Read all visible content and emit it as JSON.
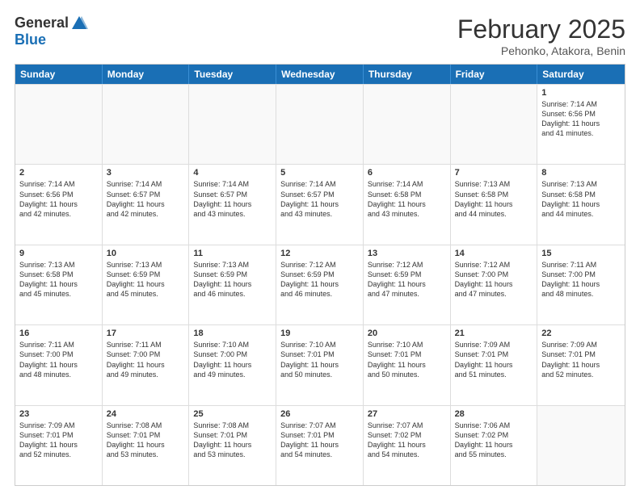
{
  "header": {
    "logo_general": "General",
    "logo_blue": "Blue",
    "month_title": "February 2025",
    "subtitle": "Pehonko, Atakora, Benin"
  },
  "days_of_week": [
    "Sunday",
    "Monday",
    "Tuesday",
    "Wednesday",
    "Thursday",
    "Friday",
    "Saturday"
  ],
  "weeks": [
    [
      {
        "day": "",
        "lines": [],
        "empty": true
      },
      {
        "day": "",
        "lines": [],
        "empty": true
      },
      {
        "day": "",
        "lines": [],
        "empty": true
      },
      {
        "day": "",
        "lines": [],
        "empty": true
      },
      {
        "day": "",
        "lines": [],
        "empty": true
      },
      {
        "day": "",
        "lines": [],
        "empty": true
      },
      {
        "day": "1",
        "lines": [
          "Sunrise: 7:14 AM",
          "Sunset: 6:56 PM",
          "Daylight: 11 hours",
          "and 41 minutes."
        ]
      }
    ],
    [
      {
        "day": "2",
        "lines": [
          "Sunrise: 7:14 AM",
          "Sunset: 6:56 PM",
          "Daylight: 11 hours",
          "and 42 minutes."
        ]
      },
      {
        "day": "3",
        "lines": [
          "Sunrise: 7:14 AM",
          "Sunset: 6:57 PM",
          "Daylight: 11 hours",
          "and 42 minutes."
        ]
      },
      {
        "day": "4",
        "lines": [
          "Sunrise: 7:14 AM",
          "Sunset: 6:57 PM",
          "Daylight: 11 hours",
          "and 43 minutes."
        ]
      },
      {
        "day": "5",
        "lines": [
          "Sunrise: 7:14 AM",
          "Sunset: 6:57 PM",
          "Daylight: 11 hours",
          "and 43 minutes."
        ]
      },
      {
        "day": "6",
        "lines": [
          "Sunrise: 7:14 AM",
          "Sunset: 6:58 PM",
          "Daylight: 11 hours",
          "and 43 minutes."
        ]
      },
      {
        "day": "7",
        "lines": [
          "Sunrise: 7:13 AM",
          "Sunset: 6:58 PM",
          "Daylight: 11 hours",
          "and 44 minutes."
        ]
      },
      {
        "day": "8",
        "lines": [
          "Sunrise: 7:13 AM",
          "Sunset: 6:58 PM",
          "Daylight: 11 hours",
          "and 44 minutes."
        ]
      }
    ],
    [
      {
        "day": "9",
        "lines": [
          "Sunrise: 7:13 AM",
          "Sunset: 6:58 PM",
          "Daylight: 11 hours",
          "and 45 minutes."
        ]
      },
      {
        "day": "10",
        "lines": [
          "Sunrise: 7:13 AM",
          "Sunset: 6:59 PM",
          "Daylight: 11 hours",
          "and 45 minutes."
        ]
      },
      {
        "day": "11",
        "lines": [
          "Sunrise: 7:13 AM",
          "Sunset: 6:59 PM",
          "Daylight: 11 hours",
          "and 46 minutes."
        ]
      },
      {
        "day": "12",
        "lines": [
          "Sunrise: 7:12 AM",
          "Sunset: 6:59 PM",
          "Daylight: 11 hours",
          "and 46 minutes."
        ]
      },
      {
        "day": "13",
        "lines": [
          "Sunrise: 7:12 AM",
          "Sunset: 6:59 PM",
          "Daylight: 11 hours",
          "and 47 minutes."
        ]
      },
      {
        "day": "14",
        "lines": [
          "Sunrise: 7:12 AM",
          "Sunset: 7:00 PM",
          "Daylight: 11 hours",
          "and 47 minutes."
        ]
      },
      {
        "day": "15",
        "lines": [
          "Sunrise: 7:11 AM",
          "Sunset: 7:00 PM",
          "Daylight: 11 hours",
          "and 48 minutes."
        ]
      }
    ],
    [
      {
        "day": "16",
        "lines": [
          "Sunrise: 7:11 AM",
          "Sunset: 7:00 PM",
          "Daylight: 11 hours",
          "and 48 minutes."
        ]
      },
      {
        "day": "17",
        "lines": [
          "Sunrise: 7:11 AM",
          "Sunset: 7:00 PM",
          "Daylight: 11 hours",
          "and 49 minutes."
        ]
      },
      {
        "day": "18",
        "lines": [
          "Sunrise: 7:10 AM",
          "Sunset: 7:00 PM",
          "Daylight: 11 hours",
          "and 49 minutes."
        ]
      },
      {
        "day": "19",
        "lines": [
          "Sunrise: 7:10 AM",
          "Sunset: 7:01 PM",
          "Daylight: 11 hours",
          "and 50 minutes."
        ]
      },
      {
        "day": "20",
        "lines": [
          "Sunrise: 7:10 AM",
          "Sunset: 7:01 PM",
          "Daylight: 11 hours",
          "and 50 minutes."
        ]
      },
      {
        "day": "21",
        "lines": [
          "Sunrise: 7:09 AM",
          "Sunset: 7:01 PM",
          "Daylight: 11 hours",
          "and 51 minutes."
        ]
      },
      {
        "day": "22",
        "lines": [
          "Sunrise: 7:09 AM",
          "Sunset: 7:01 PM",
          "Daylight: 11 hours",
          "and 52 minutes."
        ]
      }
    ],
    [
      {
        "day": "23",
        "lines": [
          "Sunrise: 7:09 AM",
          "Sunset: 7:01 PM",
          "Daylight: 11 hours",
          "and 52 minutes."
        ]
      },
      {
        "day": "24",
        "lines": [
          "Sunrise: 7:08 AM",
          "Sunset: 7:01 PM",
          "Daylight: 11 hours",
          "and 53 minutes."
        ]
      },
      {
        "day": "25",
        "lines": [
          "Sunrise: 7:08 AM",
          "Sunset: 7:01 PM",
          "Daylight: 11 hours",
          "and 53 minutes."
        ]
      },
      {
        "day": "26",
        "lines": [
          "Sunrise: 7:07 AM",
          "Sunset: 7:01 PM",
          "Daylight: 11 hours",
          "and 54 minutes."
        ]
      },
      {
        "day": "27",
        "lines": [
          "Sunrise: 7:07 AM",
          "Sunset: 7:02 PM",
          "Daylight: 11 hours",
          "and 54 minutes."
        ]
      },
      {
        "day": "28",
        "lines": [
          "Sunrise: 7:06 AM",
          "Sunset: 7:02 PM",
          "Daylight: 11 hours",
          "and 55 minutes."
        ]
      },
      {
        "day": "",
        "lines": [],
        "empty": true
      }
    ]
  ]
}
